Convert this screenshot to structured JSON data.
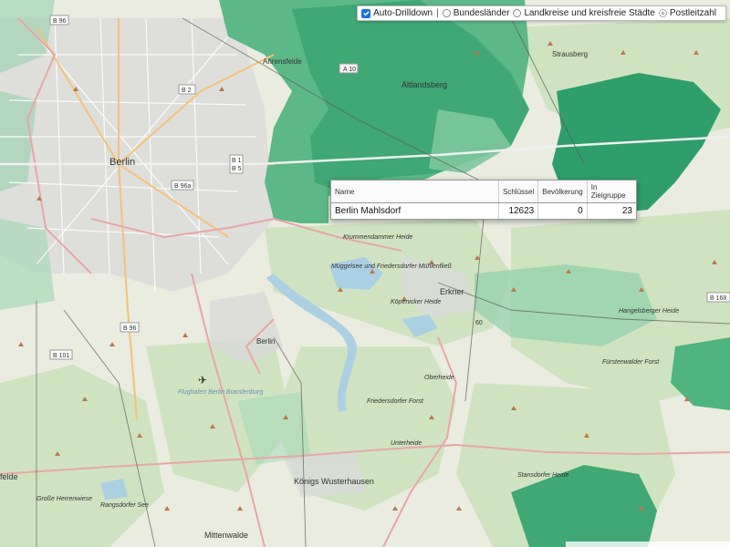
{
  "toolbar": {
    "auto_drilldown": {
      "label": "Auto-Drilldown",
      "checked": true
    },
    "separator": "|",
    "layers": [
      {
        "label": "Bundesländer",
        "selected": false
      },
      {
        "label": "Landkreise und kreisfreie Städte",
        "selected": false
      },
      {
        "label": "Postleitzahl",
        "selected": true
      }
    ]
  },
  "popup": {
    "headers": [
      "Name",
      "Schlüssel",
      "Bevölkerung",
      "In Zielgruppe"
    ],
    "row": [
      "Berlin Mahlsdorf",
      "12623",
      "0",
      "23"
    ]
  },
  "map": {
    "place_labels": {
      "berlin": "Berlin",
      "berlin_small": "Berlin",
      "ahrensfelde": "Ahrensfelde",
      "altlandsberg": "Altlandsberg",
      "strausberg": "Strausberg",
      "erkner": "Erkner",
      "koenigs_wusterhausen": "Königs Wusterhausen",
      "mittenwalde": "Mittenwalde",
      "felde": "felde"
    },
    "area_labels": {
      "krummendammer": "Krummendammer Heide",
      "mueggelsee": "Müggelsee und Friedersdorfer Mühlenfließ",
      "koepenicker": "Köpenicker Heide",
      "oberheide": "Oberheide",
      "friedersdorfer": "Friedersdorfer Forst",
      "hangelsberger": "Hangelsberger Heide",
      "fuerstenwalder": "Fürstenwalder Forst",
      "unterheide": "Unterheide",
      "stansdorfer": "Stansdorfer Heide",
      "flughafen": "Flughafen Berlin Brandenburg",
      "grosse_herrenwiese": "Große Herrenwiese",
      "rangsdorfer": "Rangsdorfer See"
    },
    "road_labels": {
      "b96_top": "B 96",
      "a10": "A 10",
      "b2": "B 2",
      "b1b5": "B 1\nB 5",
      "b96a": "B 96a",
      "b96_mid": "B 96",
      "b101": "B 101",
      "b168": "B 168",
      "n60": "60"
    },
    "colors": {
      "base": "#e9ecdf",
      "forest": "#cfe3c1",
      "water": "#abd0e3",
      "urban": "#d9d9d9",
      "highlight_dark": "#2e9e6a",
      "highlight_mid": "#4fb47f",
      "highlight_light": "#8fd0a8",
      "road": "#e8a6a6",
      "motorway": "#e07a8a"
    }
  }
}
